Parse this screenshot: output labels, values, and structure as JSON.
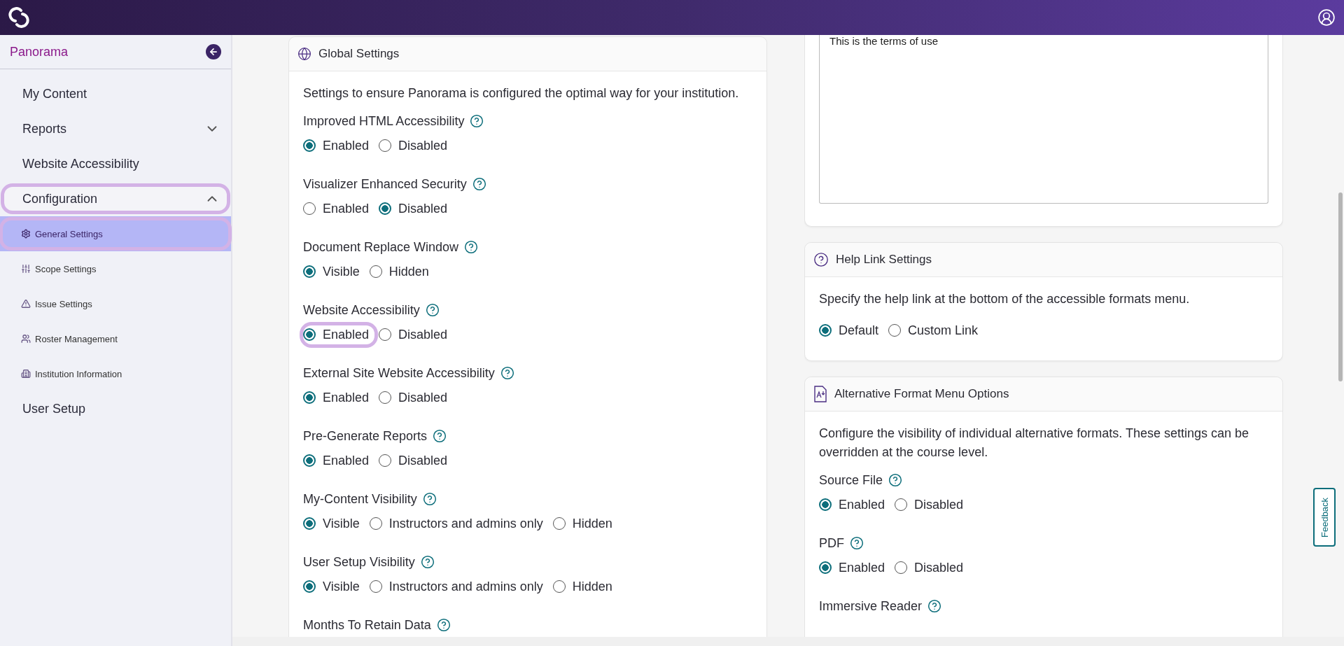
{
  "sidebar": {
    "title": "Panorama",
    "items": [
      {
        "label": "My Content",
        "selected": false
      },
      {
        "label": "Reports",
        "expanded": false,
        "selected": false
      },
      {
        "label": "Website Accessibility",
        "selected": false
      },
      {
        "label": "Configuration",
        "expanded": true,
        "selected": false,
        "focused": true,
        "children": [
          {
            "label": "General Settings",
            "selected": true,
            "focused": true
          },
          {
            "label": "Scope Settings",
            "selected": false
          },
          {
            "label": "Issue Settings",
            "selected": false
          },
          {
            "label": "Roster Management",
            "selected": false
          },
          {
            "label": "Institution Information",
            "selected": false
          }
        ]
      },
      {
        "label": "User Setup",
        "selected": false
      }
    ]
  },
  "global_settings": {
    "title": "Global Settings",
    "description": "Settings to ensure Panorama is configured the optimal way for your institution.",
    "settings": [
      {
        "label": "Improved HTML Accessibility",
        "options": [
          {
            "label": "Enabled",
            "selected": true
          },
          {
            "label": "Disabled",
            "selected": false
          }
        ]
      },
      {
        "label": "Visualizer Enhanced Security",
        "options": [
          {
            "label": "Enabled",
            "selected": false
          },
          {
            "label": "Disabled",
            "selected": true
          }
        ]
      },
      {
        "label": "Document Replace Window",
        "options": [
          {
            "label": "Visible",
            "selected": true
          },
          {
            "label": "Hidden",
            "selected": false
          }
        ]
      },
      {
        "label": "Website Accessibility",
        "options": [
          {
            "label": "Enabled",
            "selected": true,
            "focused": true
          },
          {
            "label": "Disabled",
            "selected": false
          }
        ]
      },
      {
        "label": "External Site Website Accessibility",
        "options": [
          {
            "label": "Enabled",
            "selected": true
          },
          {
            "label": "Disabled",
            "selected": false
          }
        ]
      },
      {
        "label": "Pre-Generate Reports",
        "options": [
          {
            "label": "Enabled",
            "selected": true
          },
          {
            "label": "Disabled",
            "selected": false
          }
        ]
      },
      {
        "label": "My-Content Visibility",
        "options": [
          {
            "label": "Visible",
            "selected": true
          },
          {
            "label": "Instructors and admins only",
            "selected": false
          },
          {
            "label": "Hidden",
            "selected": false
          }
        ]
      },
      {
        "label": "User Setup Visibility",
        "options": [
          {
            "label": "Visible",
            "selected": true
          },
          {
            "label": "Instructors and admins only",
            "selected": false
          },
          {
            "label": "Hidden",
            "selected": false
          }
        ]
      },
      {
        "label": "Months To Retain Data"
      }
    ]
  },
  "terms_of_use": {
    "value": "This is the terms of use"
  },
  "help_link_settings": {
    "title": "Help Link Settings",
    "description": "Specify the help link at the bottom of the accessible formats menu.",
    "options": [
      {
        "label": "Default",
        "selected": true
      },
      {
        "label": "Custom Link",
        "selected": false
      }
    ]
  },
  "alternative_format_menu": {
    "title": "Alternative Format Menu Options",
    "description": "Configure the visibility of individual alternative formats. These settings can be overridden at the course level.",
    "settings": [
      {
        "label": "Source File",
        "options": [
          {
            "label": "Enabled",
            "selected": true
          },
          {
            "label": "Disabled",
            "selected": false
          }
        ]
      },
      {
        "label": "PDF",
        "options": [
          {
            "label": "Enabled",
            "selected": true
          },
          {
            "label": "Disabled",
            "selected": false
          }
        ]
      },
      {
        "label": "Immersive Reader"
      }
    ]
  },
  "feedback_tab": {
    "label": "Feedback"
  }
}
